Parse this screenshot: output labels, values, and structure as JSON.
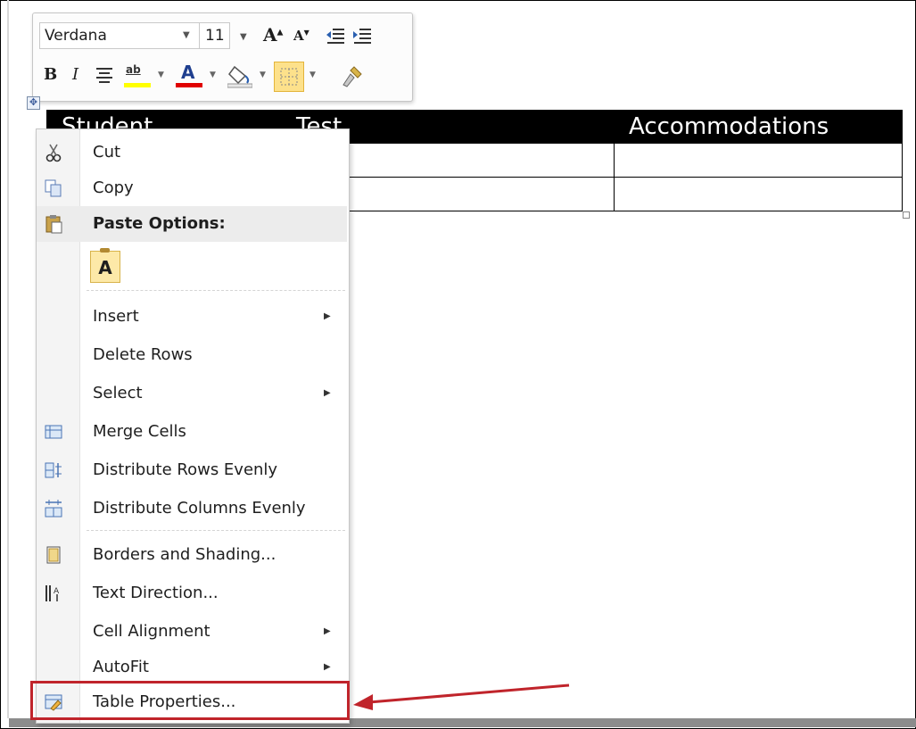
{
  "mini_toolbar": {
    "font_name": "Verdana",
    "font_size": "11",
    "grow_font_glyph": "A",
    "shrink_font_glyph": "A",
    "bold_glyph": "B",
    "italic_glyph": "I",
    "highlight_glyph": "ab",
    "font_color_glyph": "A",
    "highlight_color": "#ffff00",
    "font_color": "#e00000"
  },
  "table": {
    "header": [
      "Student",
      "Test",
      "Accommodations"
    ],
    "rows": [
      [
        "",
        "",
        ""
      ],
      [
        "",
        "",
        ""
      ]
    ]
  },
  "context_menu": {
    "cut": "Cut",
    "copy": "Copy",
    "paste_options": "Paste Options:",
    "paste_keep_text": "A",
    "insert": "Insert",
    "delete_rows": "Delete Rows",
    "select": "Select",
    "merge_cells": "Merge Cells",
    "distribute_rows": "Distribute Rows Evenly",
    "distribute_columns": "Distribute Columns Evenly",
    "borders_shading": "Borders and Shading...",
    "text_direction": "Text Direction...",
    "cell_alignment": "Cell Alignment",
    "autofit": "AutoFit",
    "table_properties": "Table Properties..."
  },
  "annotation": {
    "highlight_color": "#c0242b"
  }
}
